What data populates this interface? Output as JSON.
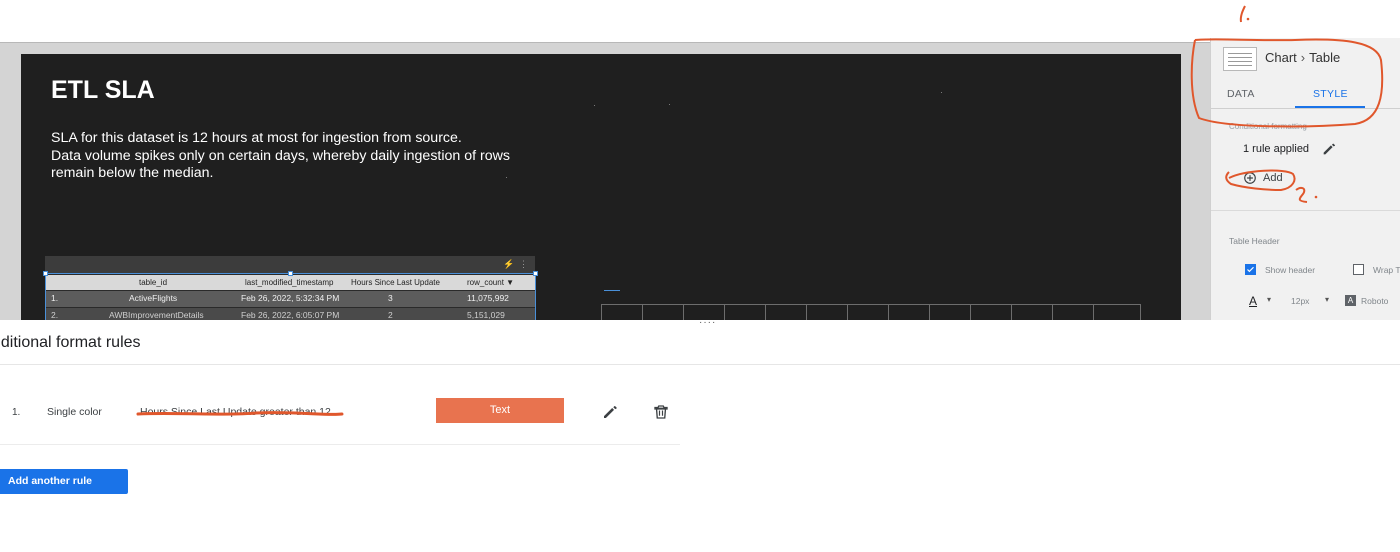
{
  "report": {
    "title": "ETL SLA",
    "description": [
      "SLA for this dataset is 12 hours at most for ingestion from source.",
      "Data volume spikes only on certain days, whereby daily ingestion of rows",
      "remain below the median."
    ]
  },
  "table": {
    "columns": [
      "table_id",
      "last_modified_timestamp",
      "Hours Since Last Update",
      "row_count ▼"
    ],
    "rows": [
      [
        "1.",
        "ActiveFlights",
        "Feb 26, 2022, 5:32:34 PM",
        "3",
        "11,075,992"
      ],
      [
        "2.",
        "AWBImprovementDetails",
        "Feb 26, 2022, 6:05:07 PM",
        "2",
        "5,151,029"
      ]
    ]
  },
  "panel": {
    "breadcrumb": [
      "Chart",
      "Table"
    ],
    "tabs": [
      "DATA",
      "STYLE"
    ],
    "active_tab": "STYLE",
    "section_label": "Conditional formatting",
    "rule_status": "1 rule applied",
    "add_label": "Add",
    "table_header_label": "Table Header",
    "show_header_label": "Show header",
    "wrap_label": "Wrap T",
    "font_size": "12px",
    "font_name": "Roboto",
    "text_color_glyph": "A"
  },
  "annotations": {
    "mark1": "1.",
    "mark2": "2."
  },
  "rules_sheet": {
    "title": "nditional format rules",
    "rules": [
      {
        "index": "1.",
        "type": "Single color",
        "condition": "Hours Since Last Update greater than 12",
        "preview_label": "Text",
        "preview_color": "#e8734f"
      }
    ],
    "add_button_label": "Add another rule"
  },
  "colors": {
    "accent": "#1a73e8",
    "annotation": "#e0572c",
    "report_bg": "#1f1f1f"
  }
}
